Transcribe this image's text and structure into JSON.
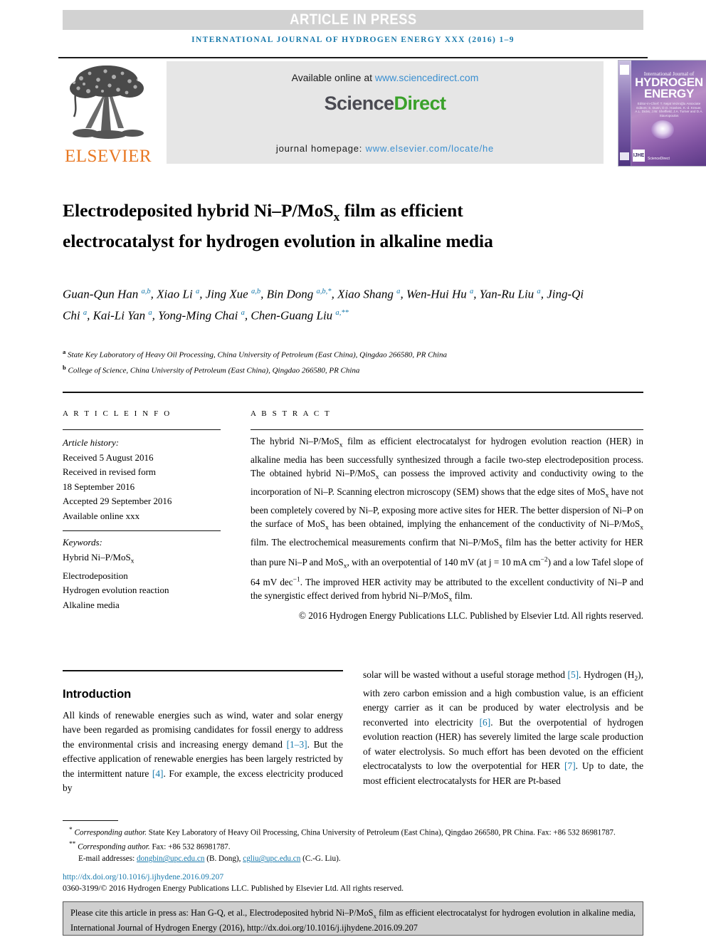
{
  "banner": {
    "text": "ARTICLE IN PRESS"
  },
  "running_head": "INTERNATIONAL JOURNAL OF HYDROGEN ENERGY XXX (2016) 1–9",
  "masthead": {
    "publisher_name": "ELSEVIER",
    "available_online_label": "Available online at ",
    "available_online_url": "www.sciencedirect.com",
    "sciencedirect_part1": "Science",
    "sciencedirect_part2": "Direct",
    "homepage_label": "journal homepage: ",
    "homepage_url": "www.elsevier.com/locate/he",
    "cover": {
      "line_intl": "International Journal of",
      "line_h1": "HYDROGEN",
      "line_h2": "ENERGY",
      "editors_block": "Editor-in-Chief: T. Nejat Veziroğlu\nAssociate Editors: S. Dunn, D.G. Hawkes, K.-d. Kreuer, A.L. Dicks, J.W. Sheffield, J.A. Turner and D.A. Stavropoulos",
      "badge": "IJHE",
      "sciencedirect_mark": "ScienceDirect"
    }
  },
  "article": {
    "title_pre": "Electrodeposited hybrid Ni–P/MoS",
    "title_sub": "x",
    "title_post": " film as efficient electrocatalyst for hydrogen evolution in alkaline media",
    "authors": [
      {
        "name": "Guan-Qun Han",
        "sup": "a,b",
        "sep": ", "
      },
      {
        "name": "Xiao Li",
        "sup": "a",
        "sep": ", "
      },
      {
        "name": "Jing Xue",
        "sup": "a,b",
        "sep": ", "
      },
      {
        "name": "Bin Dong",
        "sup": "a,b,*",
        "sep": ", "
      },
      {
        "name": "Xiao Shang",
        "sup": "a",
        "sep": ", "
      },
      {
        "name": "Wen-Hui Hu",
        "sup": "a",
        "sep": ", "
      },
      {
        "name": "Yan-Ru Liu",
        "sup": "a",
        "sep": ", "
      },
      {
        "name": "Jing-Qi Chi",
        "sup": "a",
        "sep": ", "
      },
      {
        "name": "Kai-Li Yan",
        "sup": "a",
        "sep": ", "
      },
      {
        "name": "Yong-Ming Chai",
        "sup": "a",
        "sep": ", "
      },
      {
        "name": "Chen-Guang Liu",
        "sup": "a,**",
        "sep": ""
      }
    ],
    "affiliations": [
      {
        "marker": "a",
        "text": "State Key Laboratory of Heavy Oil Processing, China University of Petroleum (East China), Qingdao 266580, PR China"
      },
      {
        "marker": "b",
        "text": "College of Science, China University of Petroleum (East China), Qingdao 266580, PR China"
      }
    ]
  },
  "article_info": {
    "heading": "A R T I C L E  I N F O",
    "history_label": "Article history:",
    "history": [
      "Received 5 August 2016",
      "Received in revised form",
      "18 September 2016",
      "Accepted 29 September 2016",
      "Available online xxx"
    ],
    "keywords_label": "Keywords:",
    "keywords": [
      "Hybrid Ni–P/MoSx",
      "Electrodeposition",
      "Hydrogen evolution reaction",
      "Alkaline media"
    ]
  },
  "abstract": {
    "heading": "A B S T R A C T",
    "text": "The hybrid Ni–P/MoSx film as efficient electrocatalyst for hydrogen evolution reaction (HER) in alkaline media has been successfully synthesized through a facile two-step electrodeposition process. The obtained hybrid Ni–P/MoSx can possess the improved activity and conductivity owing to the incorporation of Ni–P. Scanning electron microscopy (SEM) shows that the edge sites of MoSx have not been completely covered by Ni–P, exposing more active sites for HER. The better dispersion of Ni–P on the surface of MoSx has been obtained, implying the enhancement of the conductivity of Ni–P/MoSx film. The electrochemical measurements confirm that Ni–P/MoSx film has the better activity for HER than pure Ni–P and MoSx, with an overpotential of 140 mV (at j = 10 mA cm−2) and a low Tafel slope of 64 mV dec−1. The improved HER activity may be attributed to the excellent conductivity of Ni–P and the synergistic effect derived from hybrid Ni–P/MoSx film.",
    "copyright": "© 2016 Hydrogen Energy Publications LLC. Published by Elsevier Ltd. All rights reserved."
  },
  "body": {
    "section_heading": "Introduction",
    "left_column": "All kinds of renewable energies such as wind, water and solar energy have been regarded as promising candidates for fossil energy to address the environmental crisis and increasing energy demand [1–3]. But the effective application of renewable energies has been largely restricted by the intermittent nature [4]. For example, the excess electricity produced by",
    "right_column": "solar will be wasted without a useful storage method [5]. Hydrogen (H2), with zero carbon emission and a high combustion value, is an efficient energy carrier as it can be produced by water electrolysis and be reconverted into electricity [6]. But the overpotential of hydrogen evolution reaction (HER) has severely limited the large scale production of water electrolysis. So much effort has been devoted on the efficient electrocatalysts to low the overpotential for HER [7]. Up to date, the most efficient electrocatalysts for HER are Pt-based"
  },
  "footnotes": {
    "corresponding1_marker": "*",
    "corresponding1": "Corresponding author.",
    "corresponding1_rest": " State Key Laboratory of Heavy Oil Processing, China University of Petroleum (East China), Qingdao 266580, PR China. Fax: +86 532 86981787.",
    "corresponding2_marker": "**",
    "corresponding2": "Corresponding author.",
    "corresponding2_rest": " Fax: +86 532 86981787.",
    "email_label": "E-mail addresses: ",
    "email1": "dongbin@upc.edu.cn",
    "email1_owner": " (B. Dong), ",
    "email2": "cgliu@upc.edu.cn",
    "email2_owner": " (C.-G. Liu).",
    "doi": "http://dx.doi.org/10.1016/j.ijhydene.2016.09.207",
    "issn_copyright": "0360-3199/© 2016 Hydrogen Energy Publications LLC. Published by Elsevier Ltd. All rights reserved."
  },
  "cite_box": {
    "prefix": "Please cite this article in press as: Han G-Q, et al., Electrodeposited hybrid Ni–P/MoS",
    "sub": "x",
    "suffix": " film as efficient electrocatalyst for hydrogen evolution in alkaline media, International Journal of Hydrogen Energy (2016), http://dx.doi.org/10.1016/j.ijhydene.2016.09.207"
  },
  "colors": {
    "link_blue": "#1879ab",
    "sd_blue": "#3a8fd0",
    "sd_green": "#3aa12a",
    "elsevier_orange": "#e87722",
    "banner_gray": "#d2d2d2",
    "cite_box_gray": "#cfcfcf"
  }
}
